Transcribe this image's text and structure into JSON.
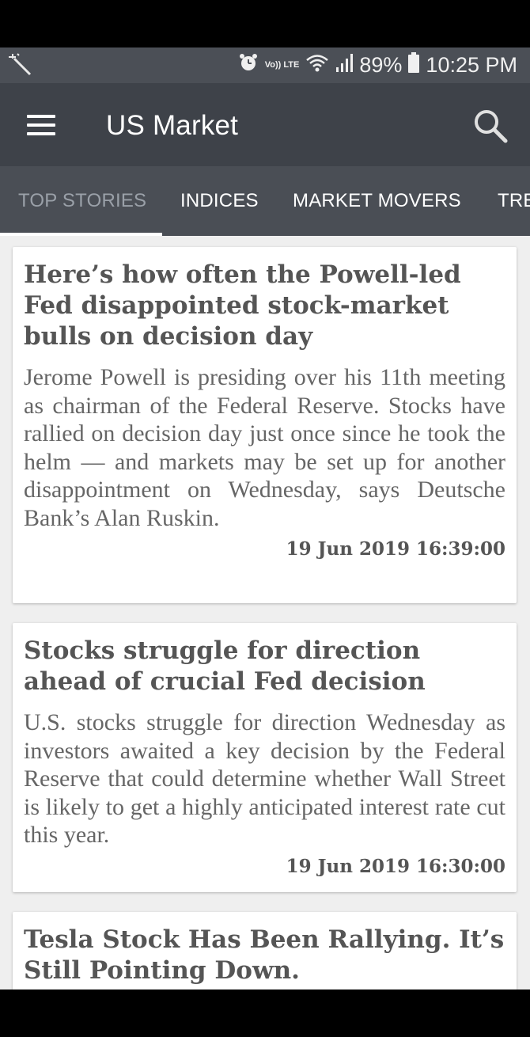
{
  "status_bar": {
    "volte_label": "Vo)) LTE",
    "battery": "89%",
    "time": "10:25 PM"
  },
  "appbar": {
    "title": "US Market"
  },
  "tabs": [
    {
      "label": "TOP STORIES",
      "active": true
    },
    {
      "label": "INDICES",
      "active": false
    },
    {
      "label": "MARKET MOVERS",
      "active": false
    },
    {
      "label": "TRE",
      "active": false
    }
  ],
  "articles": [
    {
      "headline": "Here’s how often the Powell-led Fed disappointed stock-market bulls on decision day",
      "summary": "Jerome Powell is presiding over his 11th meeting as chairman of the Federal Reserve. Stocks have rallied on decision day just once since he took the helm — and markets may be set up for another disappointment on Wednesday, says Deutsche Bank’s Alan Ruskin.",
      "date": "19 Jun 2019 16:39:00"
    },
    {
      "headline": "Stocks struggle for direction ahead of crucial Fed decision",
      "summary": "U.S. stocks struggle for direction Wednesday as investors awaited a key decision by the Federal Reserve that could determine whether Wall Street is likely to get a highly anticipated interest rate cut this year.",
      "date": "19 Jun 2019 16:30:00"
    },
    {
      "headline": "Tesla Stock Has Been Rallying. It’s Still Pointing Down.",
      "summary": "",
      "date": ""
    }
  ],
  "colors": {
    "appbar": "#3e4249",
    "tabbar": "#4a4e55",
    "background": "#efefef",
    "headline": "#555555"
  }
}
